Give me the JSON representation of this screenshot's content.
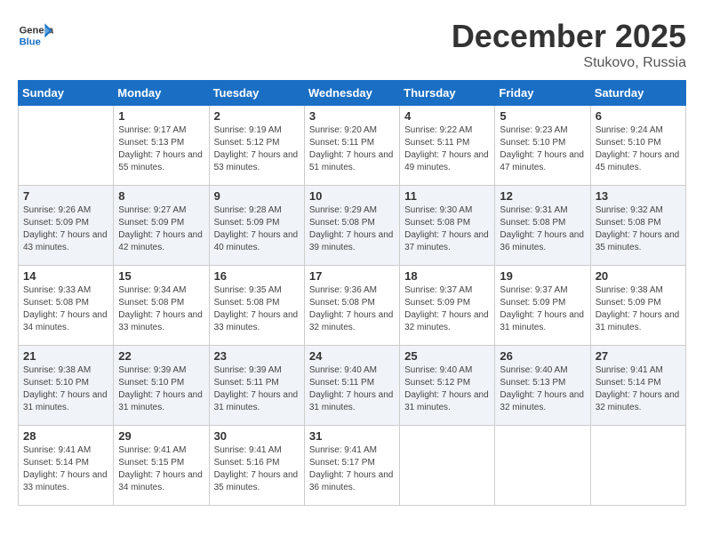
{
  "header": {
    "logo_line1": "General",
    "logo_line2": "Blue",
    "month_year": "December 2025",
    "location": "Stukovo, Russia"
  },
  "days_of_week": [
    "Sunday",
    "Monday",
    "Tuesday",
    "Wednesday",
    "Thursday",
    "Friday",
    "Saturday"
  ],
  "weeks": [
    [
      {
        "day": "",
        "sunrise": "",
        "sunset": "",
        "daylight": ""
      },
      {
        "day": "1",
        "sunrise": "Sunrise: 9:17 AM",
        "sunset": "Sunset: 5:13 PM",
        "daylight": "Daylight: 7 hours and 55 minutes."
      },
      {
        "day": "2",
        "sunrise": "Sunrise: 9:19 AM",
        "sunset": "Sunset: 5:12 PM",
        "daylight": "Daylight: 7 hours and 53 minutes."
      },
      {
        "day": "3",
        "sunrise": "Sunrise: 9:20 AM",
        "sunset": "Sunset: 5:11 PM",
        "daylight": "Daylight: 7 hours and 51 minutes."
      },
      {
        "day": "4",
        "sunrise": "Sunrise: 9:22 AM",
        "sunset": "Sunset: 5:11 PM",
        "daylight": "Daylight: 7 hours and 49 minutes."
      },
      {
        "day": "5",
        "sunrise": "Sunrise: 9:23 AM",
        "sunset": "Sunset: 5:10 PM",
        "daylight": "Daylight: 7 hours and 47 minutes."
      },
      {
        "day": "6",
        "sunrise": "Sunrise: 9:24 AM",
        "sunset": "Sunset: 5:10 PM",
        "daylight": "Daylight: 7 hours and 45 minutes."
      }
    ],
    [
      {
        "day": "7",
        "sunrise": "Sunrise: 9:26 AM",
        "sunset": "Sunset: 5:09 PM",
        "daylight": "Daylight: 7 hours and 43 minutes."
      },
      {
        "day": "8",
        "sunrise": "Sunrise: 9:27 AM",
        "sunset": "Sunset: 5:09 PM",
        "daylight": "Daylight: 7 hours and 42 minutes."
      },
      {
        "day": "9",
        "sunrise": "Sunrise: 9:28 AM",
        "sunset": "Sunset: 5:09 PM",
        "daylight": "Daylight: 7 hours and 40 minutes."
      },
      {
        "day": "10",
        "sunrise": "Sunrise: 9:29 AM",
        "sunset": "Sunset: 5:08 PM",
        "daylight": "Daylight: 7 hours and 39 minutes."
      },
      {
        "day": "11",
        "sunrise": "Sunrise: 9:30 AM",
        "sunset": "Sunset: 5:08 PM",
        "daylight": "Daylight: 7 hours and 37 minutes."
      },
      {
        "day": "12",
        "sunrise": "Sunrise: 9:31 AM",
        "sunset": "Sunset: 5:08 PM",
        "daylight": "Daylight: 7 hours and 36 minutes."
      },
      {
        "day": "13",
        "sunrise": "Sunrise: 9:32 AM",
        "sunset": "Sunset: 5:08 PM",
        "daylight": "Daylight: 7 hours and 35 minutes."
      }
    ],
    [
      {
        "day": "14",
        "sunrise": "Sunrise: 9:33 AM",
        "sunset": "Sunset: 5:08 PM",
        "daylight": "Daylight: 7 hours and 34 minutes."
      },
      {
        "day": "15",
        "sunrise": "Sunrise: 9:34 AM",
        "sunset": "Sunset: 5:08 PM",
        "daylight": "Daylight: 7 hours and 33 minutes."
      },
      {
        "day": "16",
        "sunrise": "Sunrise: 9:35 AM",
        "sunset": "Sunset: 5:08 PM",
        "daylight": "Daylight: 7 hours and 33 minutes."
      },
      {
        "day": "17",
        "sunrise": "Sunrise: 9:36 AM",
        "sunset": "Sunset: 5:08 PM",
        "daylight": "Daylight: 7 hours and 32 minutes."
      },
      {
        "day": "18",
        "sunrise": "Sunrise: 9:37 AM",
        "sunset": "Sunset: 5:09 PM",
        "daylight": "Daylight: 7 hours and 32 minutes."
      },
      {
        "day": "19",
        "sunrise": "Sunrise: 9:37 AM",
        "sunset": "Sunset: 5:09 PM",
        "daylight": "Daylight: 7 hours and 31 minutes."
      },
      {
        "day": "20",
        "sunrise": "Sunrise: 9:38 AM",
        "sunset": "Sunset: 5:09 PM",
        "daylight": "Daylight: 7 hours and 31 minutes."
      }
    ],
    [
      {
        "day": "21",
        "sunrise": "Sunrise: 9:38 AM",
        "sunset": "Sunset: 5:10 PM",
        "daylight": "Daylight: 7 hours and 31 minutes."
      },
      {
        "day": "22",
        "sunrise": "Sunrise: 9:39 AM",
        "sunset": "Sunset: 5:10 PM",
        "daylight": "Daylight: 7 hours and 31 minutes."
      },
      {
        "day": "23",
        "sunrise": "Sunrise: 9:39 AM",
        "sunset": "Sunset: 5:11 PM",
        "daylight": "Daylight: 7 hours and 31 minutes."
      },
      {
        "day": "24",
        "sunrise": "Sunrise: 9:40 AM",
        "sunset": "Sunset: 5:11 PM",
        "daylight": "Daylight: 7 hours and 31 minutes."
      },
      {
        "day": "25",
        "sunrise": "Sunrise: 9:40 AM",
        "sunset": "Sunset: 5:12 PM",
        "daylight": "Daylight: 7 hours and 31 minutes."
      },
      {
        "day": "26",
        "sunrise": "Sunrise: 9:40 AM",
        "sunset": "Sunset: 5:13 PM",
        "daylight": "Daylight: 7 hours and 32 minutes."
      },
      {
        "day": "27",
        "sunrise": "Sunrise: 9:41 AM",
        "sunset": "Sunset: 5:14 PM",
        "daylight": "Daylight: 7 hours and 32 minutes."
      }
    ],
    [
      {
        "day": "28",
        "sunrise": "Sunrise: 9:41 AM",
        "sunset": "Sunset: 5:14 PM",
        "daylight": "Daylight: 7 hours and 33 minutes."
      },
      {
        "day": "29",
        "sunrise": "Sunrise: 9:41 AM",
        "sunset": "Sunset: 5:15 PM",
        "daylight": "Daylight: 7 hours and 34 minutes."
      },
      {
        "day": "30",
        "sunrise": "Sunrise: 9:41 AM",
        "sunset": "Sunset: 5:16 PM",
        "daylight": "Daylight: 7 hours and 35 minutes."
      },
      {
        "day": "31",
        "sunrise": "Sunrise: 9:41 AM",
        "sunset": "Sunset: 5:17 PM",
        "daylight": "Daylight: 7 hours and 36 minutes."
      },
      {
        "day": "",
        "sunrise": "",
        "sunset": "",
        "daylight": ""
      },
      {
        "day": "",
        "sunrise": "",
        "sunset": "",
        "daylight": ""
      },
      {
        "day": "",
        "sunrise": "",
        "sunset": "",
        "daylight": ""
      }
    ]
  ]
}
